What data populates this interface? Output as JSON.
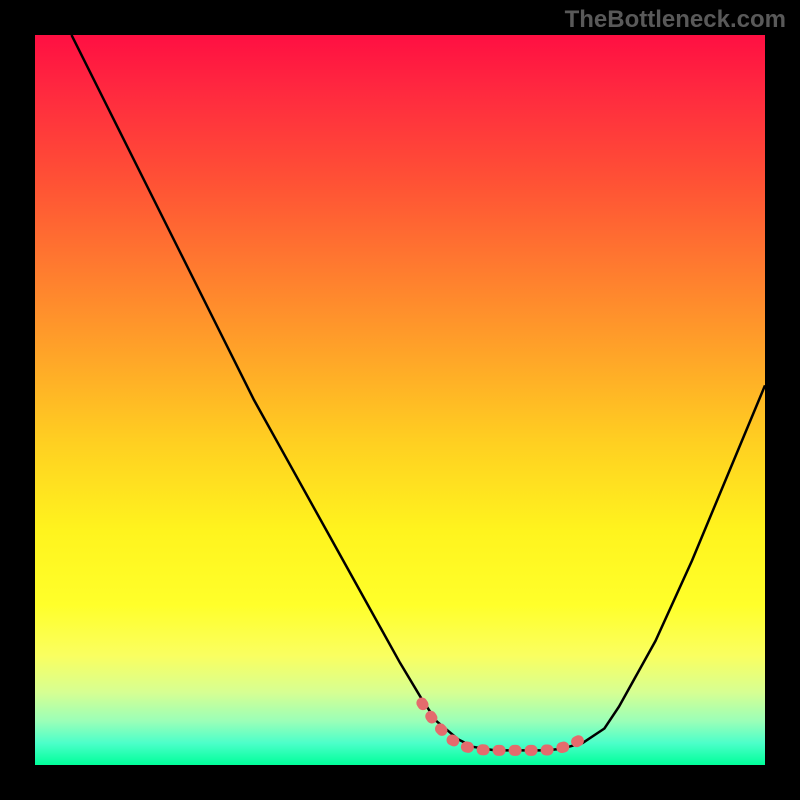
{
  "watermark": "TheBottleneck.com",
  "chart_data": {
    "type": "line",
    "title": "",
    "xlabel": "",
    "ylabel": "",
    "xlim": [
      0,
      100
    ],
    "ylim": [
      0,
      100
    ],
    "note": "No axis tick labels are visible in the image; x and y values below are estimated from pixel positions as percentages of the plot area width/height (y = 0 at bottom, 100 at top).",
    "series": [
      {
        "name": "main-curve",
        "color": "#000000",
        "x": [
          5,
          10,
          15,
          20,
          25,
          30,
          35,
          40,
          45,
          50,
          53,
          55,
          58,
          60,
          63,
          65,
          68,
          70,
          72,
          75,
          78,
          80,
          85,
          90,
          95,
          100
        ],
        "y": [
          100,
          90,
          80,
          70,
          60,
          50,
          41,
          32,
          23,
          14,
          9,
          6,
          3.5,
          2.5,
          2,
          2,
          2,
          2,
          2.2,
          3,
          5,
          8,
          17,
          28,
          40,
          52
        ]
      },
      {
        "name": "highlight-segment",
        "color": "#e46b6d",
        "x": [
          53,
          55,
          57,
          59,
          61,
          63,
          65,
          67,
          69,
          71,
          73,
          75
        ],
        "y": [
          8.5,
          5.5,
          3.5,
          2.5,
          2.1,
          2.0,
          2.0,
          2.0,
          2.0,
          2.1,
          2.6,
          3.6
        ]
      }
    ],
    "gradient_stops": [
      {
        "pos": 0,
        "color": "#ff0f42"
      },
      {
        "pos": 8,
        "color": "#ff2a3f"
      },
      {
        "pos": 20,
        "color": "#ff5135"
      },
      {
        "pos": 32,
        "color": "#ff7b2f"
      },
      {
        "pos": 44,
        "color": "#ffa528"
      },
      {
        "pos": 56,
        "color": "#ffd021"
      },
      {
        "pos": 68,
        "color": "#fff41e"
      },
      {
        "pos": 78,
        "color": "#ffff2a"
      },
      {
        "pos": 85,
        "color": "#faff60"
      },
      {
        "pos": 90,
        "color": "#d7ff92"
      },
      {
        "pos": 94,
        "color": "#9affb8"
      },
      {
        "pos": 97,
        "color": "#4cffc9"
      },
      {
        "pos": 100,
        "color": "#00ff9a"
      }
    ]
  }
}
